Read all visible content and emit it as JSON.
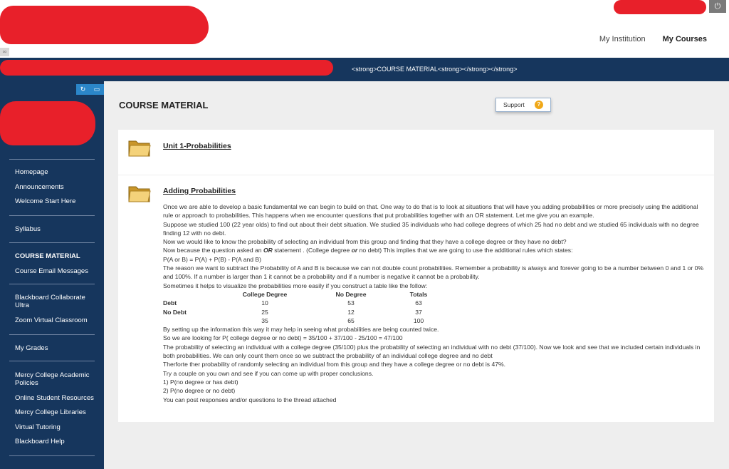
{
  "header": {
    "nav": [
      {
        "label": "My Institution",
        "active": false
      },
      {
        "label": "My Courses",
        "active": true
      }
    ],
    "power_icon": "power-icon"
  },
  "banner": {
    "title": "<strong>COURSE MATERIAL<strong></strong></strong>"
  },
  "sidebar": {
    "groups": [
      [
        {
          "label": "Homepage"
        },
        {
          "label": "Announcements"
        },
        {
          "label": "Welcome Start Here"
        }
      ],
      [
        {
          "label": "Syllabus"
        }
      ],
      [
        {
          "label": "COURSE MATERIAL",
          "active": true
        },
        {
          "label": "Course Email Messages"
        }
      ],
      [
        {
          "label": "Blackboard Collaborate Ultra"
        },
        {
          "label": "Zoom Virtual Classroom"
        }
      ],
      [
        {
          "label": "My Grades"
        }
      ],
      [
        {
          "label": "Mercy College Academic Policies"
        },
        {
          "label": "Online Student Resources"
        },
        {
          "label": "Mercy College Libraries"
        },
        {
          "label": "Virtual Tutoring"
        },
        {
          "label": "Blackboard Help"
        }
      ]
    ]
  },
  "main": {
    "page_title": "COURSE MATERIAL",
    "support_label": "Support",
    "help_glyph": "?",
    "items": [
      {
        "title": "Unit 1-Probabilities"
      },
      {
        "title": "Adding Probabilities",
        "para1": "Once we are able to develop a basic fundamental we can begin to build on that.  One way to do that is to look at situations that will have you adding probabilities or more precisely using the additional rule or approach to probabilities.  This happens when we encounter questions that put probabilities together with an OR statement.  Let me give you an example.",
        "para2": "Suppose we studied 100 (22 year olds) to find out about their debt situation.  We studied 35 individuals who had college degrees of which 25 had no debt and we studied 65 individuals with no degree finding 12 with no debt.",
        "para3": "Now we would like to know the probability of selecting an individual from this group and finding that they have a college degree or they have no debt?",
        "para4_a": "Now because the question asked an ",
        "para4_b": "OR",
        "para4_c": " statement .  (College degree  ",
        "para4_d": "or",
        "para4_e": " no debt) This implies that we are going to use the additional rules which states:",
        "para5": "P(A or B) = P(A) + P(B) - P(A and B)",
        "para6": "The reason we want to subtract the Probability of A and B is because we can not double count probabilities.  Remember a probability is always and forever going to be a number between 0 and 1 or 0% and 100%.   If a number is larger than 1 it cannot be a probability and if a number is negative it cannot be a probability.",
        "para7": "Sometimes it helps to visualize the probabilities more easily if you construct a table like the follow:",
        "table": {
          "headers": [
            "",
            "College Degree",
            "No Degree",
            "Totals"
          ],
          "rows": [
            [
              "Debt",
              "10",
              "53",
              "63"
            ],
            [
              "No Debt",
              "25",
              "12",
              "37"
            ],
            [
              "",
              "35",
              "65",
              "100"
            ]
          ]
        },
        "para8": "By setting up the information this way it may help in seeing what probabilities are being counted twice.",
        "para9": " So we are looking for P( college degree or no debt) = 35/100 + 37/100 - 25/100 = 47/100",
        "para10": "The probability of selecting an individual with a college degree (35/100) plus the probability of selecting an individual with no debt (37/100). Now we look and see that we included certain individuals in both probabilities. We can only count them once so we subtract the probability of  an individual  college degree and no debt",
        "para11": "Therforte ther probability of randomly selecting an individual from this group and they have a college degree or  no debt is 47%.",
        "para12": "Try a couple on you own and see if you can come up with proper conclusions.",
        "para13": "1)  P(no degree or has debt)",
        "para14": "2)  P(no degree or no debt)",
        "para15": "You can post responses and/or questions to the thread attached"
      }
    ]
  },
  "colors": {
    "banner": "#16365d",
    "sidebar": "#16365d",
    "content_bg": "#eeeeee",
    "help_icon": "#f0a818",
    "side_tools": "#2b86c9"
  }
}
